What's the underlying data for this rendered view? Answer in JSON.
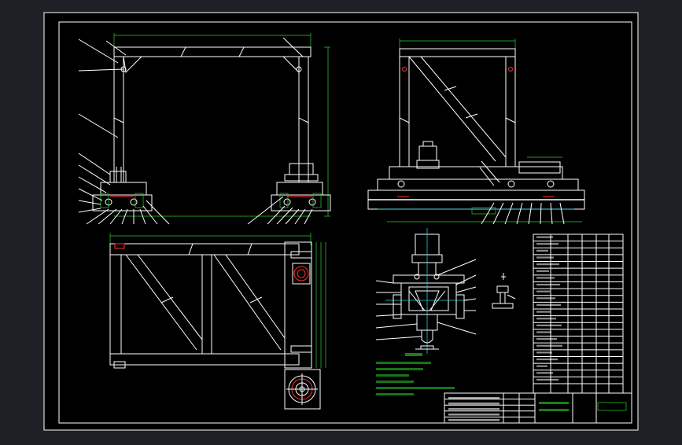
{
  "drawing": {
    "colors": {
      "background": "#000000",
      "outer_frame": "#1f1f26",
      "line": "#ffffff",
      "dimension": "#2bd12b",
      "center": "#20d0d0",
      "accent_red": "#ff3030",
      "accent_magenta": "#e040e0"
    },
    "views": {
      "front": {
        "name": "front-view"
      },
      "side": {
        "name": "side-view"
      },
      "top": {
        "name": "top-view"
      },
      "section": {
        "name": "gear-section-view"
      },
      "rail_detail": {
        "name": "rail-detail-view"
      }
    },
    "notes_count": 6,
    "parts_rows": 22,
    "title_block_rows": 5
  }
}
